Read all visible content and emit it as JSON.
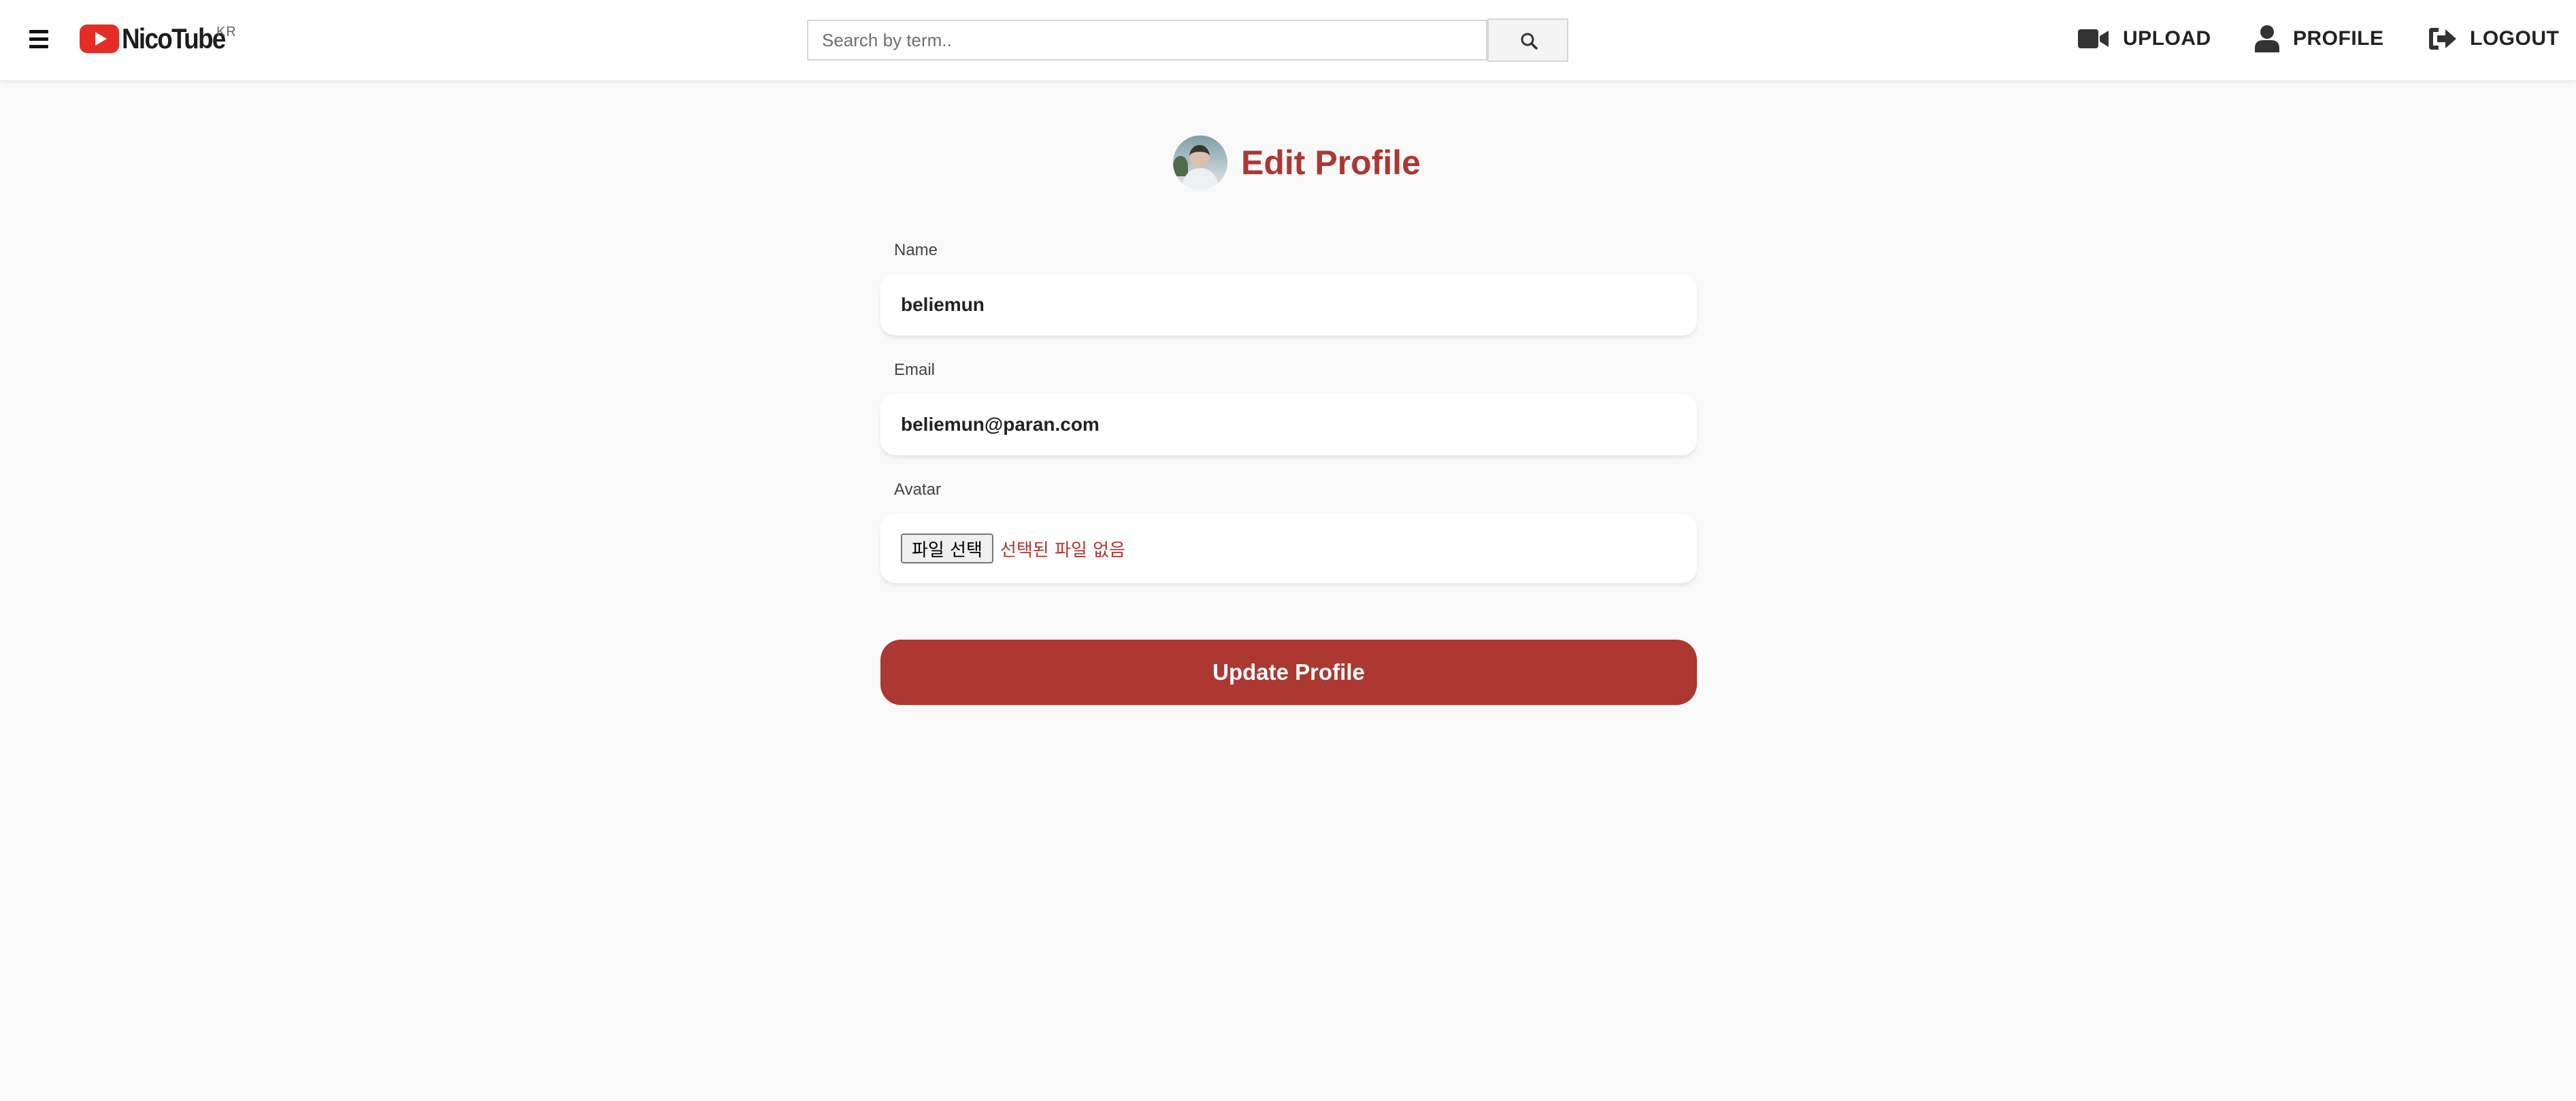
{
  "header": {
    "menu_icon": "hamburger-menu-icon",
    "logo": {
      "icon": "play-badge-icon",
      "text": "NicoTube",
      "superscript": "KR"
    },
    "search": {
      "placeholder": "Search by term..",
      "value": "",
      "icon": "search-icon"
    },
    "nav": {
      "upload": {
        "label": "UPLOAD",
        "icon": "video-camera-icon"
      },
      "profile": {
        "label": "PROFILE",
        "icon": "user-icon"
      },
      "logout": {
        "label": "LOGOUT",
        "icon": "sign-out-icon"
      }
    }
  },
  "main": {
    "title": "Edit Profile",
    "fields": {
      "name": {
        "label": "Name",
        "value": "beliemun"
      },
      "email": {
        "label": "Email",
        "value": "beliemun@paran.com"
      },
      "avatar": {
        "label": "Avatar",
        "button_label": "파일 선택",
        "status": "선택된 파일 없음"
      }
    },
    "submit_label": "Update Profile"
  },
  "colors": {
    "accent": "#ad3731",
    "logo_red": "#e52d27",
    "page_background": "#f9f9f9",
    "header_background": "#ffffff"
  }
}
